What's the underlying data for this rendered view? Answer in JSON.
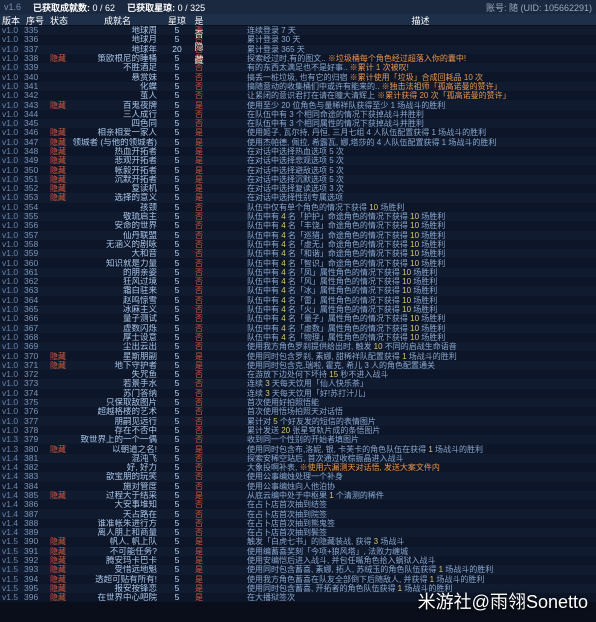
{
  "top": {
    "version": "v1.6",
    "ach_label": "已获取成就数:",
    "ach_val": "0 / 62",
    "star_label": "已获取星琼:",
    "star_val": "0 / 325",
    "user": "账号: 随 (UID: 105662291)"
  },
  "cols": {
    "ver": "版本",
    "id": "序号",
    "st": "状态",
    "name": "成就名",
    "pts": "星琼",
    "hid": "是否隐藏",
    "prog": "",
    "desc": "描述"
  },
  "watermark": "米游社@雨翎Sonetto",
  "rows": [
    {
      "v": "v1.0",
      "id": "335",
      "st": "",
      "n": "地球周",
      "p": "5",
      "h": "否",
      "pr": "",
      "d": "连续登录 7 天"
    },
    {
      "v": "v1.0",
      "id": "336",
      "st": "",
      "n": "地球月",
      "p": "5",
      "h": "否",
      "pr": "",
      "d": "累计登录 30 天"
    },
    {
      "v": "v1.0",
      "id": "337",
      "st": "",
      "n": "地球年",
      "p": "20",
      "h": "否",
      "pr": "",
      "d": "累计登录 365 天"
    },
    {
      "v": "v1.0",
      "id": "338",
      "st": "隐藏",
      "n": "策欧根尼的睡桶",
      "p": "5",
      "h": "是",
      "pr": "",
      "d": "探索经过时,有的图文.. <span class='hl-o'>※垃圾桶每个角色经过超落入你的囊中!</span>"
    },
    {
      "v": "v1.0",
      "id": "339",
      "st": "",
      "n": "不胜酒足",
      "p": "5",
      "h": "否",
      "pr": "",
      "d": "有的东西太满足也不是好事.. <span class='hl-o'>※累计 1 次被叹!</span>"
    },
    {
      "v": "v1.0",
      "id": "340",
      "st": "",
      "n": "悬赏妹",
      "p": "5",
      "h": "否",
      "pr": "",
      "d": "搞丢一桩垃圾, 也有它的归宿 <span class='hl-o'>※累计使用「垃圾」合成回耗品 10 次</span>"
    },
    {
      "v": "v1.0",
      "id": "341",
      "st": "",
      "n": "化蝶",
      "p": "5",
      "h": "否",
      "pr": "",
      "d": "搞随意动的收集桶们中或许有能来的.. <span class='hl-o'>※独击法祖师「孤高诺曼的赞许」</span>"
    },
    {
      "v": "v1.0",
      "id": "342",
      "st": "",
      "n": "茧人",
      "p": "5",
      "h": "否",
      "pr": "",
      "d": "让紧闭的意识君打在请在瞳大清辉上 <span class='hl-o'>※累计获得 20 次「孤高诺曼的赞许」</span>"
    },
    {
      "v": "v1.0",
      "id": "343",
      "st": "隐藏",
      "n": "百鬼夜牌",
      "p": "5",
      "h": "是",
      "pr": "",
      "d": "使用至少 20 位角色与量稀祥队获得至少 1 场战斗的胜利"
    },
    {
      "v": "v1.0",
      "id": "344",
      "st": "",
      "n": "三人成行",
      "p": "5",
      "h": "否",
      "pr": "",
      "d": "在队伍中有 3 个相同命途的情况下获掉战斗并胜利"
    },
    {
      "v": "v1.0",
      "id": "345",
      "st": "",
      "n": "四色同",
      "p": "5",
      "h": "否",
      "pr": "",
      "d": "在队伍中有 3 个相同属性的情况下获掉战斗并胜利"
    },
    {
      "v": "v1.0",
      "id": "346",
      "st": "隐藏",
      "n": "相亲相爱一家人",
      "p": "5",
      "h": "是",
      "pr": "",
      "d": "使用姬子, 瓦尔持, 丹恒, 三月七组 4 人队伍配置获得 1 场战斗的胜利"
    },
    {
      "v": "v1.0",
      "id": "347",
      "st": "隐藏",
      "n": "领城者 (与他的领城者)",
      "p": "5",
      "h": "是",
      "pr": "",
      "d": "使用杰帕德, 佩拉, 希露瓦, 娜,塔莎的 4 人队伍配置获得 1 场战斗的胜利"
    },
    {
      "v": "v1.0",
      "id": "348",
      "st": "隐藏",
      "n": "热血开拓者",
      "p": "5",
      "h": "是",
      "pr": "",
      "d": "在对话中选择热血选项 5 次"
    },
    {
      "v": "v1.0",
      "id": "349",
      "st": "隐藏",
      "n": "悲观开拓者",
      "p": "5",
      "h": "是",
      "pr": "",
      "d": "在对话中选择悲观选项 5 次"
    },
    {
      "v": "v1.0",
      "id": "350",
      "st": "隐藏",
      "n": "帐毅开拓者",
      "p": "5",
      "h": "是",
      "pr": "",
      "d": "在对话中选择避敌选项 5 次"
    },
    {
      "v": "v1.0",
      "id": "351",
      "st": "隐藏",
      "n": "沉默开拓者",
      "p": "5",
      "h": "是",
      "pr": "",
      "d": "在对话中选择沉默选项 5 次"
    },
    {
      "v": "v1.0",
      "id": "352",
      "st": "隐藏",
      "n": "复读机",
      "p": "5",
      "h": "是",
      "pr": "",
      "d": "在对话中选择复读选项 3 次"
    },
    {
      "v": "v1.0",
      "id": "353",
      "st": "隐藏",
      "n": "选择的意义",
      "p": "5",
      "h": "是",
      "pr": "",
      "d": "在对话中选择性别专属选项"
    },
    {
      "v": "v1.0",
      "id": "354",
      "st": "",
      "n": "孩颈",
      "p": "5",
      "h": "否",
      "pr": "",
      "d": "队伍中仅有单个角色的情况下获得 <span class='hl-y'>10</span> 场胜利"
    },
    {
      "v": "v1.0",
      "id": "355",
      "st": "",
      "n": "敬琉启主",
      "p": "5",
      "h": "否",
      "pr": "",
      "d": "队伍中有 <span class='hl-y'>4</span> 名「护护」命途角色的情况下获得 <span class='hl-y'>10</span> 场胜利"
    },
    {
      "v": "v1.0",
      "id": "356",
      "st": "",
      "n": "安命的世界",
      "p": "5",
      "h": "否",
      "pr": "",
      "d": "队伍中有 <span class='hl-y'>4</span> 名「丰饶」命途角色的情况下获得 <span class='hl-y'>10</span> 场胜利"
    },
    {
      "v": "v1.0",
      "id": "357",
      "st": "",
      "n": "仙丹联盟",
      "p": "5",
      "h": "否",
      "pr": "",
      "d": "队伍中有 <span class='hl-y'>4</span> 名「巡猎」命途角色的情况下获得 <span class='hl-y'>10</span> 场胜利"
    },
    {
      "v": "v1.0",
      "id": "358",
      "st": "",
      "n": "无涵义的剧咏",
      "p": "5",
      "h": "否",
      "pr": "",
      "d": "队伍中有 <span class='hl-y'>4</span> 名「虚无」命途角色的情况下获得 <span class='hl-y'>10</span> 场胜利"
    },
    {
      "v": "v1.0",
      "id": "359",
      "st": "",
      "n": "大和音",
      "p": "5",
      "h": "否",
      "pr": "",
      "d": "队伍中有 <span class='hl-y'>4</span> 名「和谐」命途角色的情况下获得 <span class='hl-y'>10</span> 场胜利"
    },
    {
      "v": "v1.0",
      "id": "360",
      "st": "",
      "n": "知识就是力量",
      "p": "5",
      "h": "否",
      "pr": "",
      "d": "队伍中有 <span class='hl-y'>4</span> 名「智识」命途角色的情况下获得 <span class='hl-y'>10</span> 场胜利"
    },
    {
      "v": "v1.0",
      "id": "361",
      "st": "",
      "n": "的朋亲姿",
      "p": "5",
      "h": "否",
      "pr": "",
      "d": "队伍中有 <span class='hl-y'>4</span> 名「凤」属性角色的情况下获得 <span class='hl-y'>10</span> 场胜利"
    },
    {
      "v": "v1.0",
      "id": "362",
      "st": "",
      "n": "狂风过境",
      "p": "5",
      "h": "否",
      "pr": "",
      "d": "队伍中有 <span class='hl-y'>4</span> 名「风」属性角色的情况下获得 <span class='hl-y'>10</span> 场胜利"
    },
    {
      "v": "v1.0",
      "id": "363",
      "st": "",
      "n": "霜白驻来",
      "p": "5",
      "h": "否",
      "pr": "",
      "d": "队伍中有 <span class='hl-y'>4</span> 名「冰」属性角色的情况下获得 <span class='hl-y'>10</span> 场胜利"
    },
    {
      "v": "v1.0",
      "id": "364",
      "st": "",
      "n": "赵鸣惊雪",
      "p": "5",
      "h": "否",
      "pr": "",
      "d": "队伍中有 <span class='hl-y'>4</span> 名「雷」属性角色的情况下获得 <span class='hl-y'>10</span> 场胜利"
    },
    {
      "v": "v1.0",
      "id": "365",
      "st": "",
      "n": "冰麻主义",
      "p": "5",
      "h": "否",
      "pr": "",
      "d": "队伍中有 <span class='hl-y'>4</span> 名「火」属性角色的情况下获得 <span class='hl-y'>10</span> 场胜利"
    },
    {
      "v": "v1.0",
      "id": "366",
      "st": "",
      "n": "量子测试",
      "p": "5",
      "h": "否",
      "pr": "",
      "d": "队伍中有 <span class='hl-y'>4</span> 名「量子」属性角色的情况下获得 <span class='hl-y'>10</span> 场胜利"
    },
    {
      "v": "v1.0",
      "id": "367",
      "st": "",
      "n": "虚数闪烁",
      "p": "5",
      "h": "否",
      "pr": "",
      "d": "队伍中有 <span class='hl-y'>4</span> 名「虚数」属性角色的情况下获得 <span class='hl-y'>10</span> 场胜利"
    },
    {
      "v": "v1.0",
      "id": "368",
      "st": "",
      "n": "厚士设意",
      "p": "5",
      "h": "否",
      "pr": "",
      "d": "队伍中有 <span class='hl-y'>4</span> 名「物理」属性角色的情况下获得 <span class='hl-y'>10</span> 场胜利"
    },
    {
      "v": "v1.0",
      "id": "369",
      "st": "",
      "n": "尘出云出",
      "p": "5",
      "h": "否",
      "pr": "",
      "d": "使用我方角色罗刹提供给出时, 触发 <span class='hl-y'>10</span> 不同的启战生命语音"
    },
    {
      "v": "v1.0",
      "id": "370",
      "st": "隐藏",
      "n": "星斯朋副",
      "p": "5",
      "h": "是",
      "pr": "",
      "d": "使用同时包含罗刹, 素娜, 甜稀祥队配置获得 <span class='hl-y'>1</span> 场战斗的胜利"
    },
    {
      "v": "v1.0",
      "id": "371",
      "st": "隐藏",
      "n": "地下守护者",
      "p": "5",
      "h": "是",
      "pr": "",
      "d": "使用同时包含克,瑞啦, 霍克, 希儿 3 人的角色配置通关"
    },
    {
      "v": "v1.0",
      "id": "372",
      "st": "",
      "n": "失咒鱼",
      "p": "5",
      "h": "否",
      "pr": "",
      "d": "在游放下边处何下坏持 <span class='hl-y'>15</span> 秒不进入战斗"
    },
    {
      "v": "v1.0",
      "id": "373",
      "st": "",
      "n": "若景手水",
      "p": "5",
      "h": "否",
      "pr": "",
      "d": "连续 <span class='hl-y'>3</span> 天每天饮用「仙人快乐茶」"
    },
    {
      "v": "v1.0",
      "id": "374",
      "st": "",
      "n": "苏门答纳",
      "p": "5",
      "h": "否",
      "pr": "",
      "d": "连续 <span class='hl-y'>3</span> 天每天饮用「好!苏打汁儿」"
    },
    {
      "v": "v1.0",
      "id": "375",
      "st": "",
      "n": "只保取敌图片",
      "p": "5",
      "h": "否",
      "pr": "",
      "d": "首次使用好拍照悟能"
    },
    {
      "v": "v1.0",
      "id": "376",
      "st": "",
      "n": "超越格楼的艺术",
      "p": "5",
      "h": "否",
      "pr": "",
      "d": "首次使用悟场拍照天对话悟"
    },
    {
      "v": "v1.0",
      "id": "377",
      "st": "",
      "n": "朋嗣见远行",
      "p": "5",
      "h": "否",
      "pr": "",
      "d": "累计对 <span class='hl-y'>5</span> 个好友发的短信的表情图片"
    },
    {
      "v": "v1.0",
      "id": "378",
      "st": "",
      "n": "存在不否中",
      "p": "5",
      "h": "否",
      "pr": "",
      "d": "累计发送 <span class='hl-y'>20</span> 张星穹轨片成的条悟图片"
    },
    {
      "v": "v1.3",
      "id": "379",
      "st": "",
      "n": "致世界上的一个一偶",
      "p": "5",
      "h": "否",
      "pr": "",
      "d": "收到同一个性别的开始者填图片"
    },
    {
      "v": "v1.3",
      "id": "380",
      "st": "隐藏",
      "n": "以朝道之名!",
      "p": "5",
      "h": "是",
      "pr": "",
      "d": "使用同时包含布,洛妮, 银, 卡芙卡的角色队伍在获得 <span class='hl-y'>1</span> 场战斗的胜利"
    },
    {
      "v": "v1.4",
      "id": "381",
      "st": "",
      "n": "混沌飞",
      "p": "5",
      "h": "否",
      "pr": "",
      "d": "探索安稀空站后, 首次通过收棕振晶进入战斗"
    },
    {
      "v": "v1.4",
      "id": "382",
      "st": "",
      "n": "好, 好力",
      "p": "5",
      "h": "否",
      "pr": "",
      "d": "大象投啊补表, <span class='hl-o'>※使用六漏测天对话悟, 发送大案文件内</span>"
    },
    {
      "v": "v1.4",
      "id": "383",
      "st": "",
      "n": "歆宝朋的玩笑",
      "p": "5",
      "h": "否",
      "pr": "",
      "d": "使用公事编烛处理一个补身"
    },
    {
      "v": "v1.4",
      "id": "384",
      "st": "",
      "n": "施对管度",
      "p": "5",
      "h": "否",
      "pr": "",
      "d": "使用公事编烛向人他泊协"
    },
    {
      "v": "v1.4",
      "id": "385",
      "st": "隐藏",
      "n": "过程大于结采",
      "p": "5",
      "h": "是",
      "pr": "",
      "d": "从底云编中处于中枢果 <span class='hl-y'>1</span> 个清测的稀件"
    },
    {
      "v": "v1.4",
      "id": "386",
      "st": "",
      "n": "大安事堆知",
      "p": "5",
      "h": "否",
      "pr": "",
      "d": "在占卜店首次抽到结签"
    },
    {
      "v": "v1.4",
      "id": "387",
      "st": "",
      "n": "天占路在",
      "p": "5",
      "h": "否",
      "pr": "",
      "d": "在占卜店首次抽到院签"
    },
    {
      "v": "v1.4",
      "id": "388",
      "st": "",
      "n": "谁准帐朱进行方",
      "p": "5",
      "h": "否",
      "pr": "",
      "d": "在占卜店首次抽到熊鬼签"
    },
    {
      "v": "v1.4",
      "id": "389",
      "st": "",
      "n": "离人朋上和商量",
      "p": "5",
      "h": "否",
      "pr": "",
      "d": "在占卜店首次抽到鬓签"
    },
    {
      "v": "v1.5",
      "id": "390",
      "st": "隐藏",
      "n": "帆人, 帆上队",
      "p": "5",
      "h": "是",
      "pr": "",
      "d": "触发「白虎七书」的隐藏装战, 获得 <span class='hl-y'>3</span> 场战斗"
    },
    {
      "v": "v1.5",
      "id": "391",
      "st": "隐藏",
      "n": "不可能任务?",
      "p": "5",
      "h": "是",
      "pr": "",
      "d": "使用编蓄喜奖刻「今项+狼风塔」, 法败力缠城"
    },
    {
      "v": "v1.5",
      "id": "392",
      "st": "隐藏",
      "n": "腾安玛卡巴卡",
      "p": "5",
      "h": "是",
      "pr": "",
      "d": "使用安编恺后进入战斗, 并包任嘴角色拾入蜗狱入战斗"
    },
    {
      "v": "v1.5",
      "id": "393",
      "st": "隐藏",
      "n": "受惜远地魁",
      "p": "5",
      "h": "是",
      "pr": "",
      "d": "使用同时包含蓄喜, 素娜, 拓人, 苏绒玉的角色队伍获得 <span class='hl-y'>1</span> 场战斗的胜利"
    },
    {
      "v": "v1.5",
      "id": "394",
      "st": "隐藏",
      "n": "透超可贴有所有!",
      "p": "5",
      "h": "是",
      "pr": "",
      "d": "使用我方角色蓄喜在队友全部倒下后随敌人, 并获得 <span class='hl-y'>1</span> 场战斗的胜利"
    },
    {
      "v": "v1.5",
      "id": "395",
      "st": "隐藏",
      "n": "报安按锋恋",
      "p": "5",
      "h": "是",
      "pr": "",
      "d": "使用同时包含蓄喜, 开拓者的角色队伍获得 <span class='hl-y'>1</span> 场战斗的胜利"
    },
    {
      "v": "v1.5",
      "id": "396",
      "st": "隐藏",
      "n": "在世界中心吧院",
      "p": "5",
      "h": "是",
      "pr": "",
      "d": "在大播狱签次"
    }
  ]
}
